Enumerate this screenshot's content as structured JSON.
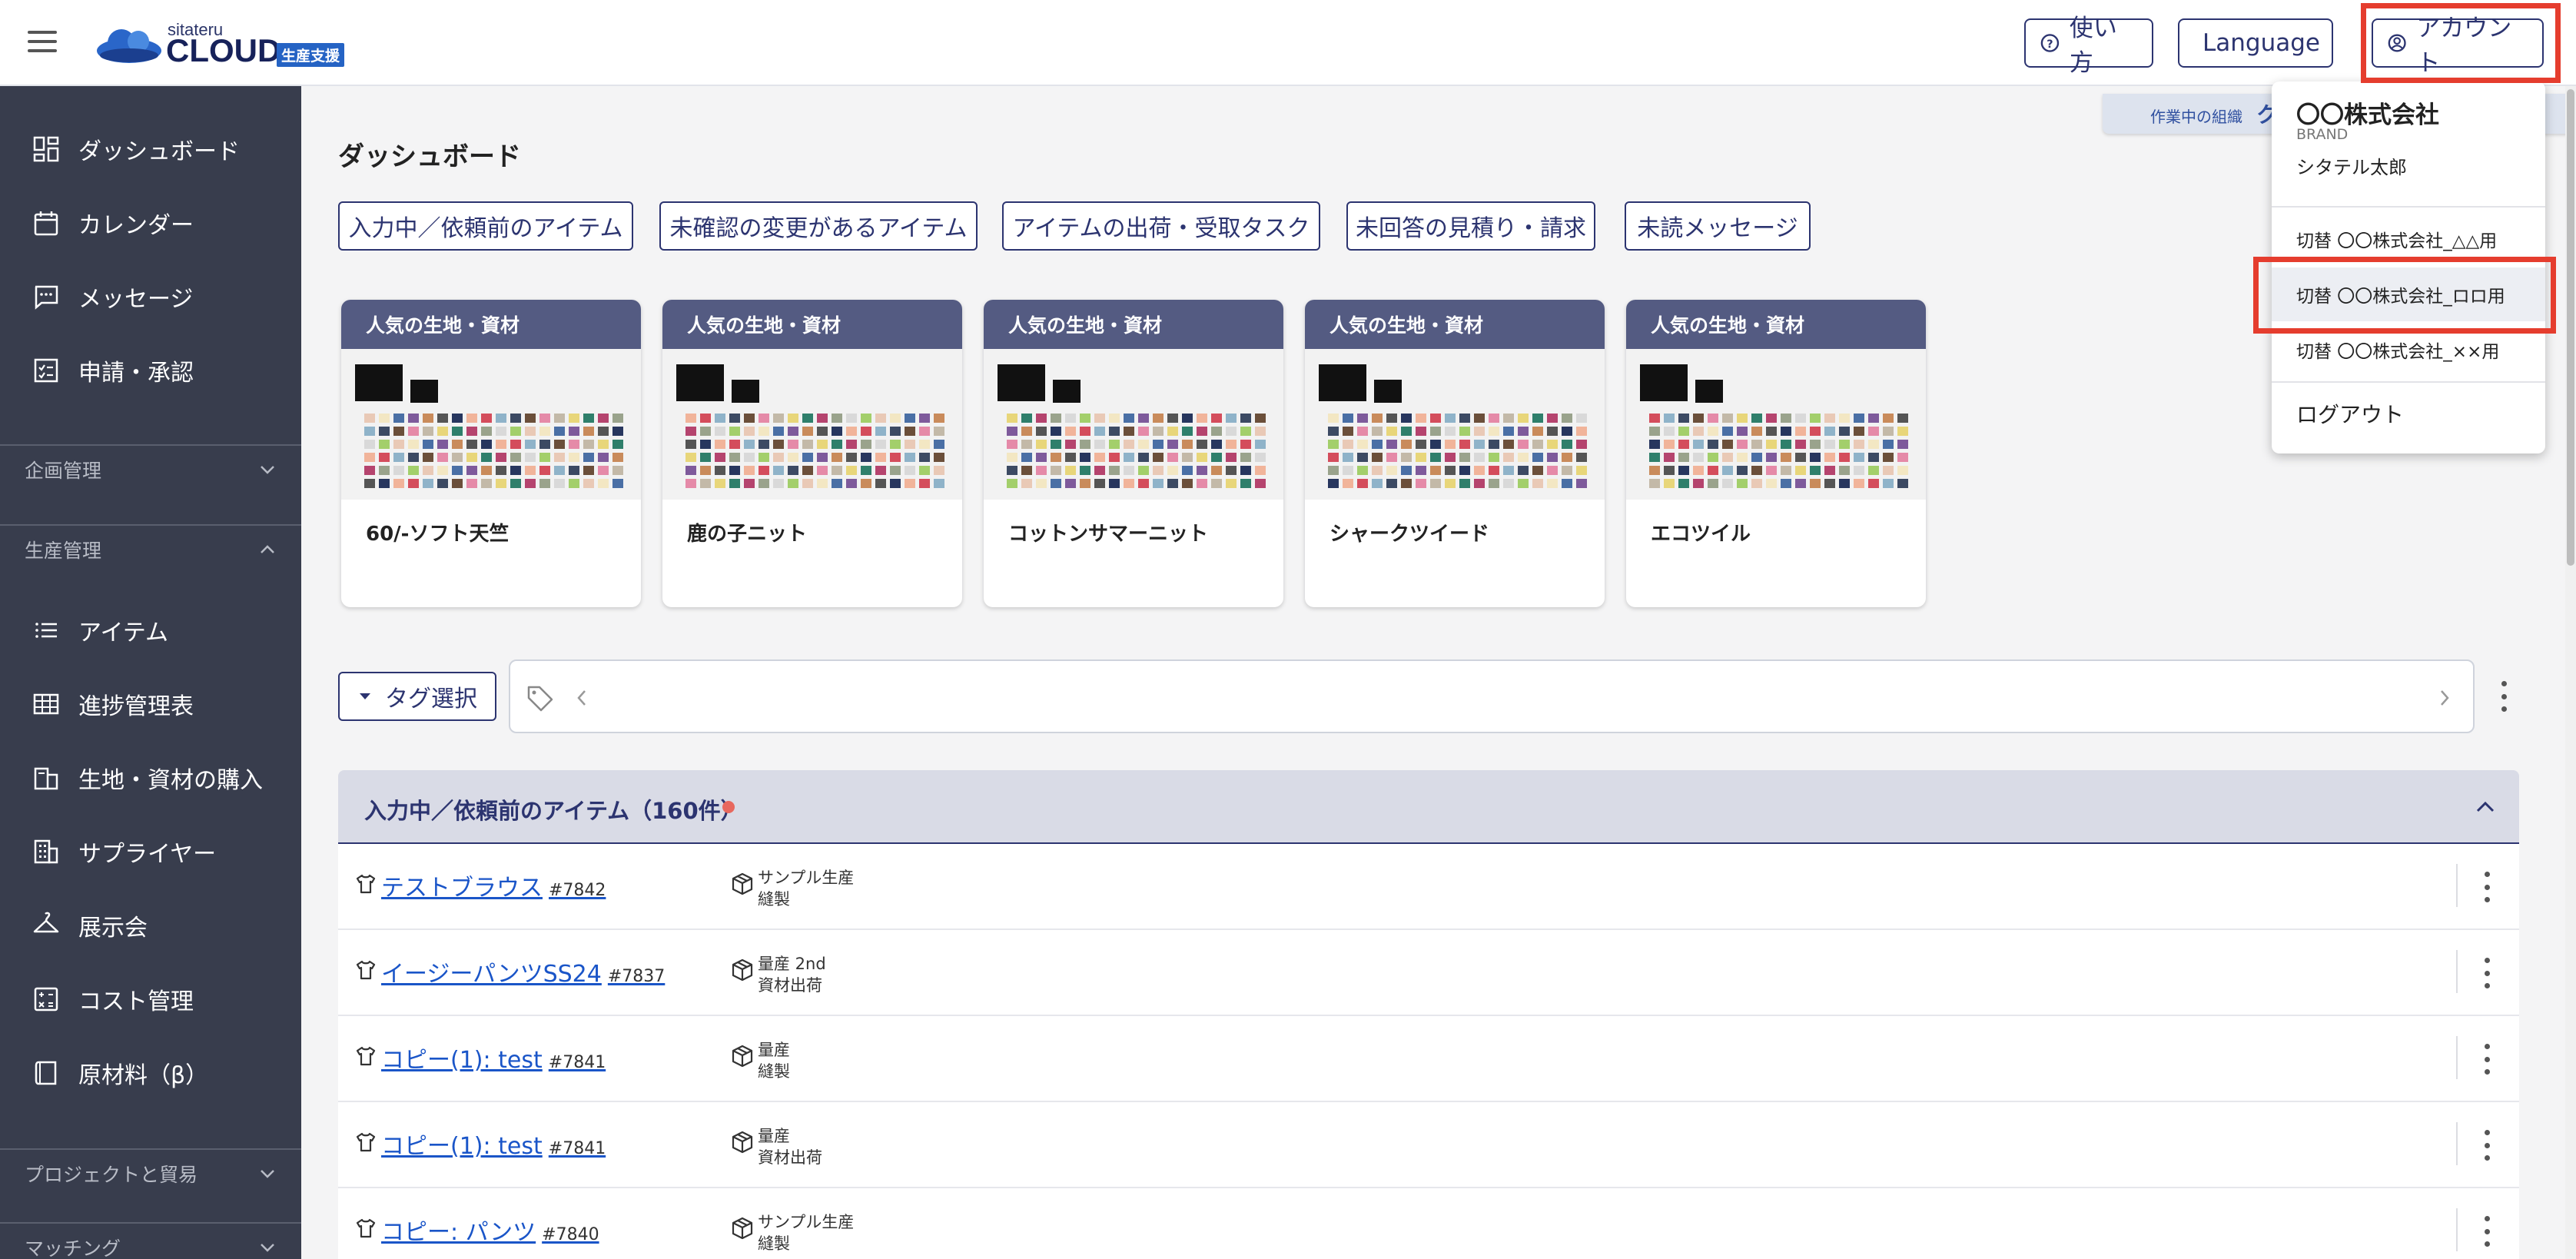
{
  "header": {
    "logo_small": "sitateru",
    "logo_big": "CLOUD",
    "logo_tag": "生産支援",
    "help_label": "使い方",
    "language_label": "Language",
    "account_label": "アカウント"
  },
  "sidebar": {
    "top_items": [
      {
        "label": "ダッシュボード",
        "icon": "dashboard-icon"
      },
      {
        "label": "カレンダー",
        "icon": "calendar-icon"
      },
      {
        "label": "メッセージ",
        "icon": "message-icon"
      },
      {
        "label": "申請・承認",
        "icon": "approval-icon"
      }
    ],
    "section_planning": "企画管理",
    "section_production": "生産管理",
    "production_items": [
      {
        "label": "アイテム",
        "icon": "list-icon"
      },
      {
        "label": "進捗管理表",
        "icon": "grid-icon"
      },
      {
        "label": "生地・資材の購入",
        "icon": "purchase-icon"
      },
      {
        "label": "サプライヤー",
        "icon": "building-icon"
      },
      {
        "label": "展示会",
        "icon": "hanger-icon"
      },
      {
        "label": "コスト管理",
        "icon": "calculator-icon"
      },
      {
        "label": "原材料（β）",
        "icon": "book-icon"
      }
    ],
    "section_project": "プロジェクトと貿易",
    "section_matching": "マッチング"
  },
  "main": {
    "title": "ダッシュボード",
    "org_label": "作業中の組織",
    "org_value": "ク",
    "filters": [
      "入力中／依頼前のアイテム",
      "未確認の変更があるアイテム",
      "アイテムの出荷・受取タスク",
      "未回答の見積り・請求",
      "未読メッセージ"
    ],
    "card_header": "人気の生地・資材",
    "cards": [
      "60/-ソフト天竺",
      "鹿の子ニット",
      "コットンサマーニット",
      "シャークツイード",
      "エコツイル"
    ],
    "tag_select": "タグ選択",
    "section_title": "入力中／依頼前のアイテム（160件）",
    "rows": [
      {
        "name": "テストブラウス",
        "number": "#7842",
        "status1": "サンプル生産",
        "status2": "縫製"
      },
      {
        "name": "イージーパンツSS24",
        "number": "#7837",
        "status1": "量産 2nd",
        "status2": "資材出荷"
      },
      {
        "name": "コピー(1): test",
        "number": "#7841",
        "status1": "量産",
        "status2": "縫製"
      },
      {
        "name": "コピー(1): test",
        "number": "#7841",
        "status1": "量産",
        "status2": "資材出荷"
      },
      {
        "name": "コピー: パンツ",
        "number": "#7840",
        "status1": "サンプル生産",
        "status2": "縫製"
      }
    ]
  },
  "account_menu": {
    "org_name": "〇〇株式会社",
    "role": "BRAND",
    "user": "シタテル太郎",
    "switches": [
      "切替 〇〇株式会社_△△用",
      "切替 〇〇株式会社_ロロ用",
      "切替 〇〇株式会社_××用"
    ],
    "logout": "ログアウト"
  },
  "colors": {
    "primary": "#2c3470",
    "sidebar_bg": "#383d4d",
    "card_header": "#545b82",
    "highlight": "#e53d2e",
    "link": "#1a55c8"
  }
}
